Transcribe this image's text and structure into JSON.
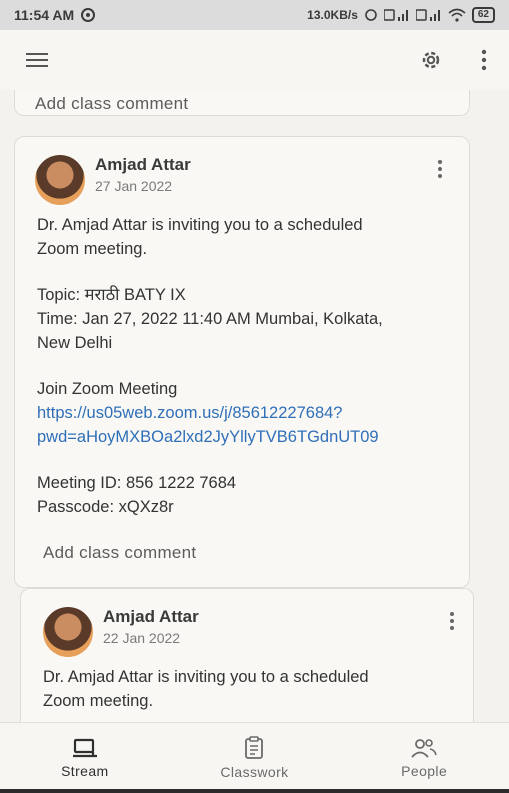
{
  "status_bar": {
    "time": "11:54 AM",
    "speed": "13.0KB/s",
    "battery": "62"
  },
  "app_bar": {
    "menu_icon": "menu-icon",
    "settings_icon": "gear-icon",
    "more_icon": "more-vert-icon"
  },
  "feed": {
    "top_card": {
      "comment_label": "Add class comment"
    },
    "posts": [
      {
        "author": "Amjad Attar",
        "date": "27 Jan 2022",
        "body": {
          "line1": "Dr. Amjad Attar is inviting you to a scheduled",
          "line2": "Zoom meeting.",
          "topic": "Topic: मराठी BATY IX",
          "time1": "Time: Jan 27, 2022 11:40 AM Mumbai, Kolkata,",
          "time2": "New Delhi",
          "join": "Join Zoom Meeting",
          "link1": "https://us05web.zoom.us/j/85612227684?",
          "link2": "pwd=aHoyMXBOa2lxd2JyYllyTVB6TGdnUT09",
          "meeting_id": "Meeting ID: 856 1222 7684",
          "passcode": "Passcode: xQXz8r"
        },
        "comment_label": "Add class comment"
      },
      {
        "author": "Amjad Attar",
        "date": "22 Jan 2022",
        "body": {
          "line1": "Dr. Amjad Attar is inviting you to a scheduled",
          "line2": "Zoom meeting."
        }
      }
    ]
  },
  "bottom_nav": {
    "items": [
      {
        "label": "Stream",
        "icon": "stream-icon",
        "active": true
      },
      {
        "label": "Classwork",
        "icon": "classwork-icon",
        "active": false
      },
      {
        "label": "People",
        "icon": "people-icon",
        "active": false
      }
    ]
  }
}
